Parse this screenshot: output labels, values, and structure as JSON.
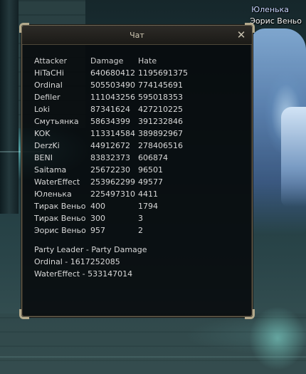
{
  "scene": {
    "overhead_names": [
      "Юленька",
      "Эорис Веньо"
    ]
  },
  "chat_window": {
    "title": "Чат",
    "close_icon": "close-icon",
    "columns": [
      "Attacker",
      "Damage",
      "Hate"
    ],
    "rows": [
      {
        "attacker": "HiTaCHi",
        "damage": "640680412",
        "hate": "1195691375"
      },
      {
        "attacker": "Ordinal",
        "damage": "505503490",
        "hate": "774145691"
      },
      {
        "attacker": "Defiler",
        "damage": "111043256",
        "hate": "595018353"
      },
      {
        "attacker": "Loki",
        "damage": "87341624",
        "hate": "427210225"
      },
      {
        "attacker": "Смутьянка",
        "damage": "58634399",
        "hate": "391232846"
      },
      {
        "attacker": "KOK",
        "damage": "113314584",
        "hate": "389892967"
      },
      {
        "attacker": "DerzKi",
        "damage": "44912672",
        "hate": "278406516"
      },
      {
        "attacker": "BENI",
        "damage": "83832373",
        "hate": "606874"
      },
      {
        "attacker": "Saitama",
        "damage": "25672230",
        "hate": "96501"
      },
      {
        "attacker": "WaterEffect",
        "damage": "253962299",
        "hate": "49577"
      },
      {
        "attacker": "Юленька",
        "damage": "225497310",
        "hate": "4411"
      },
      {
        "attacker": "Тирак Веньо",
        "damage": "400",
        "hate": "1794"
      },
      {
        "attacker": "Тирак Веньо",
        "damage": "300",
        "hate": "3"
      },
      {
        "attacker": "Эорис Веньо",
        "damage": "957",
        "hate": "2"
      }
    ],
    "party_header": "Party Leader - Party Damage",
    "party_lines": [
      "Ordinal - 1617252085",
      "WaterEffect - 533147014"
    ]
  }
}
